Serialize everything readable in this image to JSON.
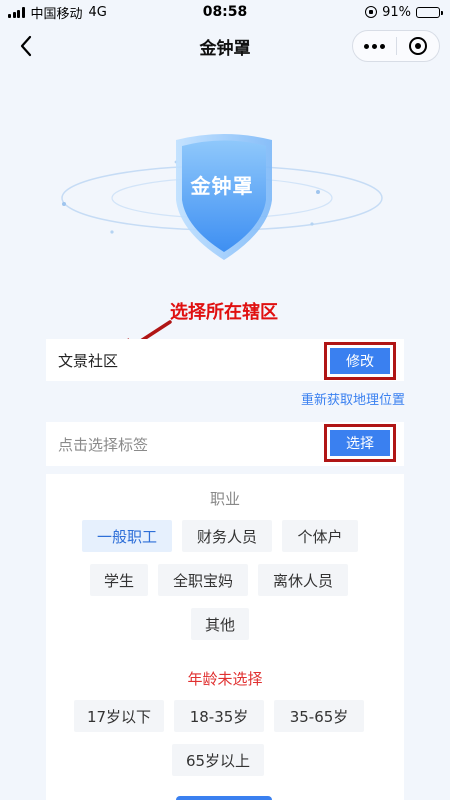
{
  "status_bar": {
    "carrier": "中国移动",
    "network": "4G",
    "time": "08:58",
    "battery": "91%",
    "battery_level": 0.91
  },
  "nav": {
    "title": "金钟罩"
  },
  "hero": {
    "shield_label": "金钟罩",
    "shield_color": "#5aa6f5"
  },
  "annotation": {
    "text": "选择所在辖区",
    "color": "#e01010"
  },
  "district": {
    "value": "文景社区",
    "modify_label": "修改",
    "relocate_label": "重新获取地理位置"
  },
  "tag": {
    "placeholder": "点击选择标签",
    "select_label": "选择"
  },
  "occupation": {
    "title": "职业",
    "options": [
      "一般职工",
      "财务人员",
      "个体户",
      "学生",
      "全职宝妈",
      "离休人员",
      "其他"
    ],
    "selected": "一般职工"
  },
  "age": {
    "title": "年龄未选择",
    "options": [
      "17岁以下",
      "18-35岁",
      "35-65岁",
      "65岁以上"
    ]
  },
  "colors": {
    "accent": "#3a80f0",
    "highlight_frame": "#b01515",
    "background": "#f2f6fc"
  }
}
